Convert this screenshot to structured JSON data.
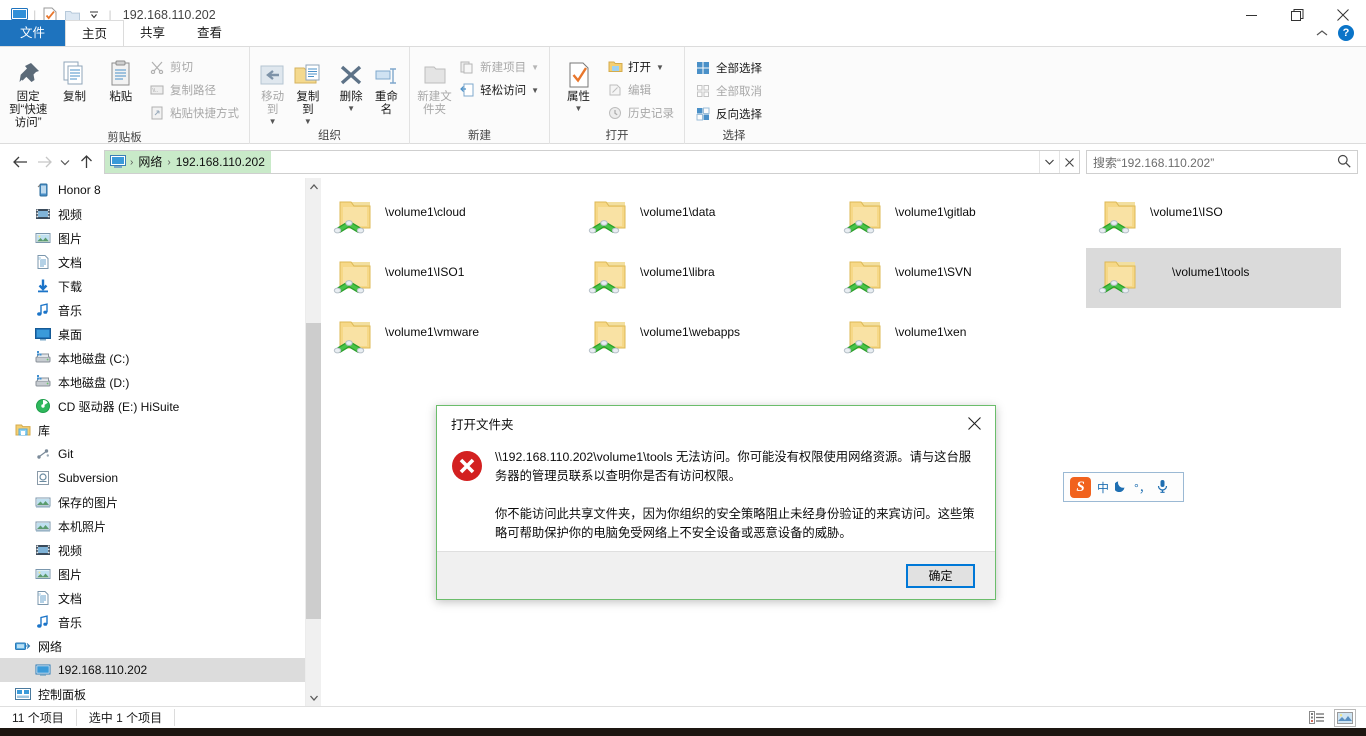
{
  "window": {
    "title": "192.168.110.202",
    "quick_access_icons": [
      "computer-icon",
      "properties-icon",
      "new-folder-icon",
      "customize-chevron-icon"
    ],
    "minimize_label": "—",
    "maximize_label": "❐",
    "close_label": "✕",
    "collapse_ribbon_label": "⌃",
    "help_label": "?"
  },
  "tabs": [
    {
      "label": "文件",
      "name": "tab-file"
    },
    {
      "label": "主页",
      "name": "tab-home"
    },
    {
      "label": "共享",
      "name": "tab-share"
    },
    {
      "label": "查看",
      "name": "tab-view"
    }
  ],
  "ribbon": {
    "groups": [
      {
        "label": "剪贴板",
        "name": "ribbon-group-clipboard",
        "big_buttons": [
          {
            "label": "固定到“快速访问”",
            "icon": "pin-icon",
            "name": "pin-to-quick-access-button",
            "disabled": false
          },
          {
            "label": "复制",
            "icon": "copy-icon",
            "name": "copy-button",
            "disabled": false
          },
          {
            "label": "粘贴",
            "icon": "paste-icon",
            "name": "paste-button",
            "disabled": false
          }
        ],
        "small_buttons": [
          {
            "label": "剪切",
            "icon": "scissors-icon",
            "name": "cut-button",
            "disabled": true
          },
          {
            "label": "复制路径",
            "icon": "copy-path-icon",
            "name": "copy-path-button",
            "disabled": true
          },
          {
            "label": "粘贴快捷方式",
            "icon": "paste-shortcut-icon",
            "name": "paste-shortcut-button",
            "disabled": true
          }
        ]
      },
      {
        "label": "组织",
        "name": "ribbon-group-organize",
        "big_buttons": [
          {
            "label": "移动到",
            "icon": "move-to-icon",
            "name": "move-to-button",
            "disabled": true,
            "caret": true
          },
          {
            "label": "复制到",
            "icon": "copy-to-icon",
            "name": "copy-to-button",
            "disabled": false,
            "caret": true
          },
          {
            "label": "删除",
            "icon": "delete-icon",
            "name": "delete-button",
            "disabled": false,
            "caret": true
          },
          {
            "label": "重命名",
            "icon": "rename-icon",
            "name": "rename-button",
            "disabled": false
          }
        ],
        "small_buttons": []
      },
      {
        "label": "新建",
        "name": "ribbon-group-new",
        "big_buttons": [
          {
            "label": "新建文件夹",
            "icon": "new-folder-icon",
            "name": "new-folder-button",
            "disabled": true
          }
        ],
        "small_buttons": [
          {
            "label": "新建项目",
            "icon": "new-item-icon",
            "name": "new-item-button",
            "disabled": true,
            "caret": true
          },
          {
            "label": "轻松访问",
            "icon": "easy-access-icon",
            "name": "easy-access-button",
            "disabled": false,
            "caret": true
          }
        ]
      },
      {
        "label": "打开",
        "name": "ribbon-group-open",
        "big_buttons": [
          {
            "label": "属性",
            "icon": "properties-icon",
            "name": "properties-button",
            "disabled": false,
            "caret": true
          }
        ],
        "small_buttons": [
          {
            "label": "打开",
            "icon": "open-icon",
            "name": "open-button",
            "disabled": false,
            "caret": true
          },
          {
            "label": "编辑",
            "icon": "edit-icon",
            "name": "edit-button",
            "disabled": true
          },
          {
            "label": "历史记录",
            "icon": "history-icon",
            "name": "history-button",
            "disabled": true
          }
        ]
      },
      {
        "label": "选择",
        "name": "ribbon-group-select",
        "big_buttons": [],
        "small_buttons": [
          {
            "label": "全部选择",
            "icon": "select-all-icon",
            "name": "select-all-button",
            "disabled": false
          },
          {
            "label": "全部取消",
            "icon": "select-none-icon",
            "name": "select-none-button",
            "disabled": true
          },
          {
            "label": "反向选择",
            "icon": "invert-selection-icon",
            "name": "invert-selection-button",
            "disabled": false
          }
        ]
      }
    ]
  },
  "address_bar": {
    "back_label": "←",
    "forward_label": "→",
    "recent_label": "⌄",
    "up_label": "↑",
    "crumbs": [
      "网络",
      "192.168.110.202"
    ],
    "crumb_separator": "›",
    "dropdown_label": "⌄",
    "refresh_label": "✕",
    "search_placeholder": "搜索“192.168.110.202”",
    "search_value": ""
  },
  "nav_pane": {
    "items": [
      {
        "label": "Honor 8",
        "icon": "phone-icon",
        "indent": 1,
        "selected": false
      },
      {
        "label": "视频",
        "icon": "video-icon",
        "indent": 1,
        "selected": false
      },
      {
        "label": "图片",
        "icon": "pictures-icon",
        "indent": 1,
        "selected": false
      },
      {
        "label": "文档",
        "icon": "documents-icon",
        "indent": 1,
        "selected": false
      },
      {
        "label": "下载",
        "icon": "downloads-icon",
        "indent": 1,
        "selected": false
      },
      {
        "label": "音乐",
        "icon": "music-icon",
        "indent": 1,
        "selected": false
      },
      {
        "label": "桌面",
        "icon": "desktop-icon",
        "indent": 1,
        "selected": false
      },
      {
        "label": "本地磁盘 (C:)",
        "icon": "hard-drive-icon",
        "indent": 1,
        "selected": false
      },
      {
        "label": "本地磁盘 (D:)",
        "icon": "hard-drive-icon",
        "indent": 1,
        "selected": false
      },
      {
        "label": "CD 驱动器 (E:) HiSuite",
        "icon": "cd-drive-icon",
        "indent": 1,
        "selected": false
      },
      {
        "label": "库",
        "icon": "library-icon",
        "indent": 0,
        "selected": false
      },
      {
        "label": "Git",
        "icon": "git-icon",
        "indent": 1,
        "selected": false
      },
      {
        "label": "Subversion",
        "icon": "subversion-icon",
        "indent": 1,
        "selected": false
      },
      {
        "label": "保存的图片",
        "icon": "saved-pictures-icon",
        "indent": 1,
        "selected": false
      },
      {
        "label": "本机照片",
        "icon": "camera-roll-icon",
        "indent": 1,
        "selected": false
      },
      {
        "label": "视频",
        "icon": "video-icon",
        "indent": 1,
        "selected": false
      },
      {
        "label": "图片",
        "icon": "pictures-icon",
        "indent": 1,
        "selected": false
      },
      {
        "label": "文档",
        "icon": "documents-icon",
        "indent": 1,
        "selected": false
      },
      {
        "label": "音乐",
        "icon": "music-icon",
        "indent": 1,
        "selected": false
      },
      {
        "label": "网络",
        "icon": "network-icon",
        "indent": 0,
        "selected": false
      },
      {
        "label": "192.168.110.202",
        "icon": "computer-icon",
        "indent": 1,
        "selected": true
      },
      {
        "label": "控制面板",
        "icon": "control-panel-icon",
        "indent": 0,
        "selected": false
      }
    ]
  },
  "files": {
    "items": [
      {
        "name": "\\volume1\\cloud",
        "icon": "network-share-folder-icon",
        "selected": false
      },
      {
        "name": "\\volume1\\data",
        "icon": "network-share-folder-icon",
        "selected": false
      },
      {
        "name": "\\volume1\\gitlab",
        "icon": "network-share-folder-icon",
        "selected": false
      },
      {
        "name": "\\volume1\\ISO",
        "icon": "network-share-folder-icon",
        "selected": false
      },
      {
        "name": "\\volume1\\ISO1",
        "icon": "network-share-folder-icon",
        "selected": false
      },
      {
        "name": "\\volume1\\libra",
        "icon": "network-share-folder-icon",
        "selected": false
      },
      {
        "name": "\\volume1\\SVN",
        "icon": "network-share-folder-icon",
        "selected": false
      },
      {
        "name": "\\volume1\\tools",
        "icon": "network-share-folder-icon",
        "selected": true
      },
      {
        "name": "\\volume1\\vmware",
        "icon": "network-share-folder-icon",
        "selected": false
      },
      {
        "name": "\\volume1\\webapps",
        "icon": "network-share-folder-icon",
        "selected": false
      },
      {
        "name": "\\volume1\\xen",
        "icon": "network-share-folder-icon",
        "selected": false
      }
    ]
  },
  "status_bar": {
    "item_count": "11 个项目",
    "selected_count": "选中 1 个项目",
    "view_details_name": "details-view-button",
    "view_large_icons_name": "large-icons-view-button"
  },
  "dialog": {
    "title": "打开文件夹",
    "close_label": "✕",
    "icon": "error-icon",
    "paragraph1": "\\\\192.168.110.202\\volume1\\tools 无法访问。你可能没有权限使用网络资源。请与这台服务器的管理员联系以查明你是否有访问权限。",
    "paragraph2": "你不能访问此共享文件夹，因为你组织的安全策略阻止未经身份验证的来宾访问。这些策略可帮助保护你的电脑免受网络上不安全设备或恶意设备的威胁。",
    "ok_label": "确定"
  },
  "ime": {
    "logo_label": "S",
    "mode_label": "中",
    "moon_label": "☾",
    "punct_label": "°，",
    "mic_label": "ᵔ",
    "items": [
      "sogou-logo-icon",
      "chinese-mode-icon",
      "moon-icon",
      "punctuation-icon",
      "microphone-icon"
    ]
  },
  "colors": {
    "accent_blue": "#1e73be",
    "crumb_green": "#c9eac9",
    "selection_gray": "#dadada",
    "error_red": "#d32020",
    "focus_blue": "#0078d7"
  }
}
